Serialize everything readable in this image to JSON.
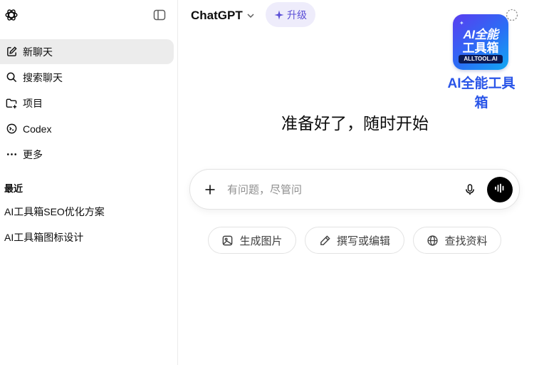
{
  "sidebar": {
    "nav_items": [
      {
        "label": "新聊天",
        "icon": "edit-icon"
      },
      {
        "label": "搜索聊天",
        "icon": "search-icon"
      },
      {
        "label": "项目",
        "icon": "folder-plus-icon"
      },
      {
        "label": "Codex",
        "icon": "codex-icon"
      },
      {
        "label": "更多",
        "icon": "more-icon"
      }
    ],
    "recent_title": "最近",
    "recent_items": [
      "AI工具箱SEO优化方案",
      "AI工具箱图标设计"
    ]
  },
  "header": {
    "model_name": "ChatGPT",
    "upgrade_label": "升级"
  },
  "promo": {
    "tile_line1": "AI全能",
    "tile_line2": "工具箱",
    "tile_badge": "ALLTOOL.AI",
    "caption": "AI全能工具箱"
  },
  "main": {
    "headline": "准备好了，随时开始",
    "composer_placeholder": "有问题，尽管问",
    "chips": [
      {
        "label": "生成图片",
        "icon": "image-icon"
      },
      {
        "label": "撰写或编辑",
        "icon": "pencil-icon"
      },
      {
        "label": "查找资料",
        "icon": "globe-icon"
      }
    ]
  },
  "colors": {
    "accent_purple": "#5b4fd6",
    "upgrade_bg": "#eeecfb",
    "sidebar_active_bg": "#ececec",
    "promo_blue": "#2a55e8"
  }
}
